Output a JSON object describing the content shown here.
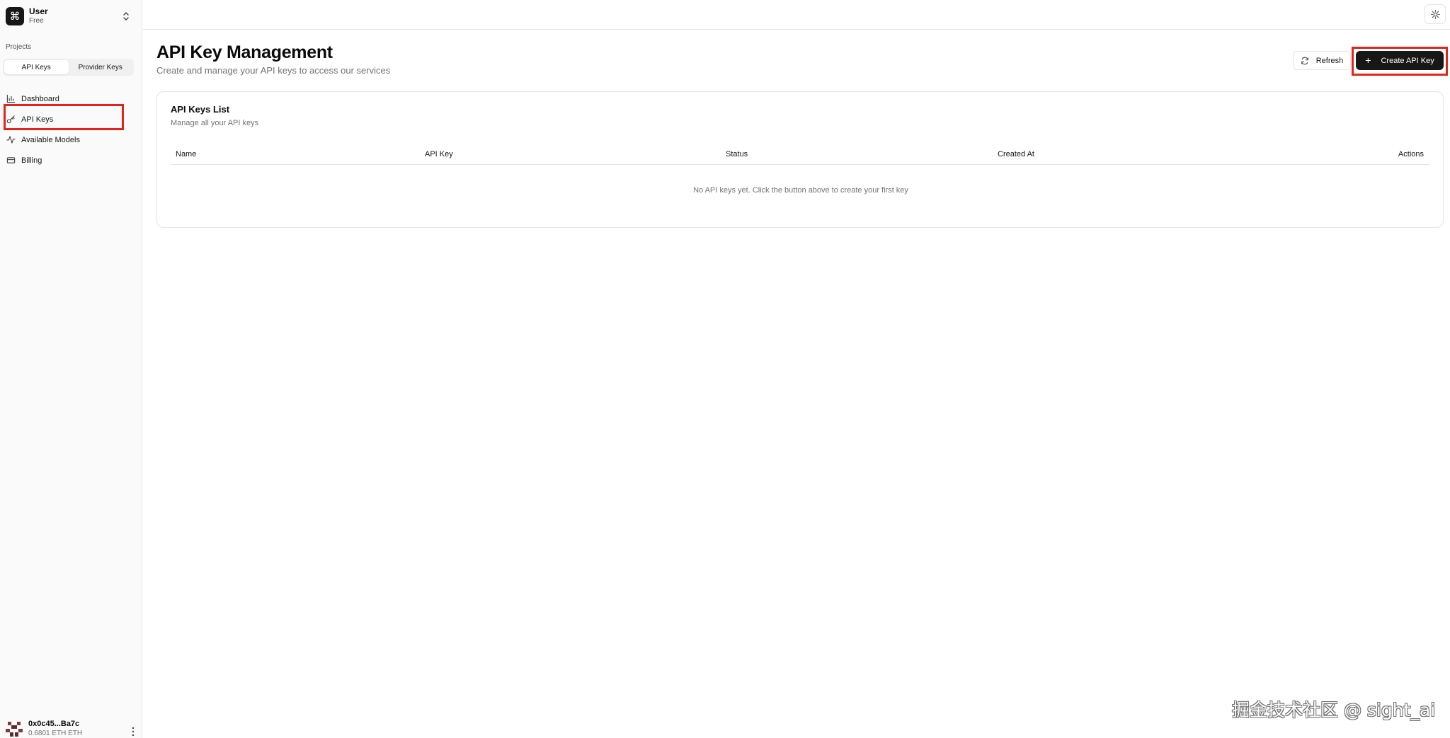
{
  "sidebar": {
    "user": {
      "name": "User",
      "plan": "Free",
      "logo_glyph": "⌘"
    },
    "section_label": "Projects",
    "segments": [
      {
        "label": "API Keys",
        "active": true
      },
      {
        "label": "Provider Keys",
        "active": false
      }
    ],
    "nav": [
      {
        "label": "Dashboard",
        "icon": "bar-chart-icon"
      },
      {
        "label": "API Keys",
        "icon": "key-icon",
        "highlighted": true
      },
      {
        "label": "Available Models",
        "icon": "activity-icon"
      },
      {
        "label": "Billing",
        "icon": "credit-card-icon"
      }
    ],
    "footer": {
      "wallet": "0x0c45...Ba7c",
      "balance": "0.6801 ETH ETH"
    }
  },
  "header": {
    "title": "API Key Management",
    "subtitle": "Create and manage your API keys to access our services",
    "refresh_label": "Refresh",
    "create_label": "Create API Key"
  },
  "card": {
    "title": "API Keys List",
    "description": "Manage all your API keys",
    "columns": [
      "Name",
      "API Key",
      "Status",
      "Created At",
      "Actions"
    ],
    "rows": [],
    "empty_message": "No API keys yet. Click the button above to create your first key"
  },
  "watermark": "掘金技术社区 @ sight_ai",
  "colors": {
    "highlight": "#e1251b",
    "primary_button": "#171717",
    "sidebar_bg": "#fafafa"
  }
}
